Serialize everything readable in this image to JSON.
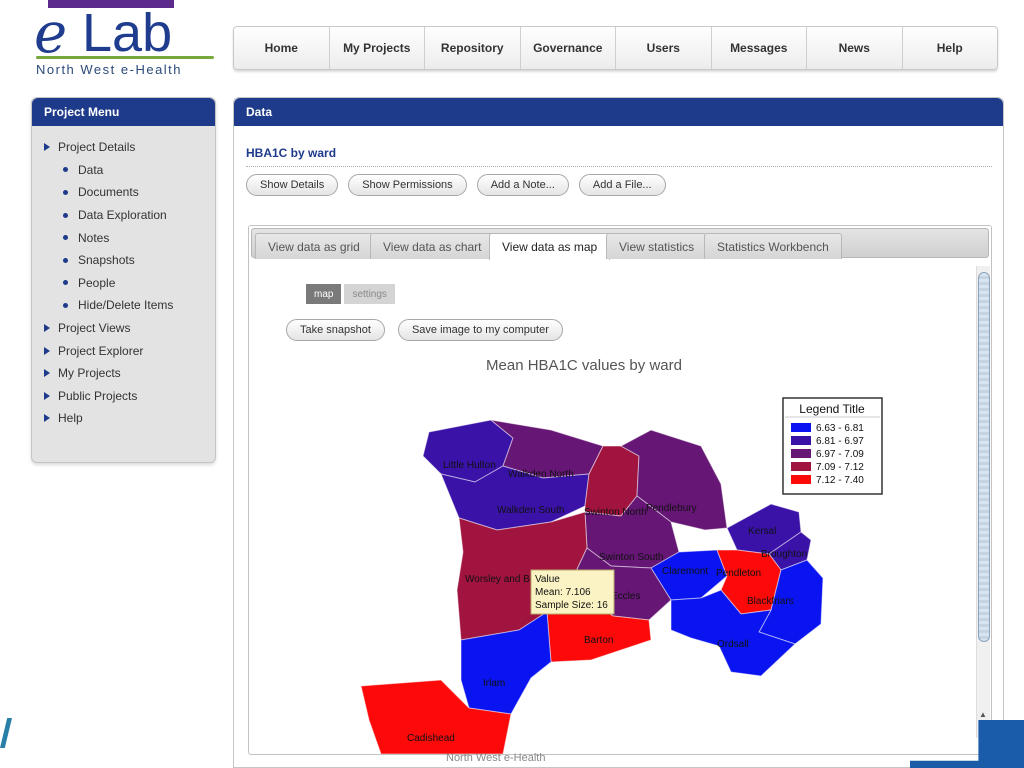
{
  "logo": {
    "text": "Lab",
    "initial": "e",
    "subtitle": "North West e-Health"
  },
  "nav": [
    {
      "label": "Home"
    },
    {
      "label": "My Projects"
    },
    {
      "label": "Repository"
    },
    {
      "label": "Governance"
    },
    {
      "label": "Users"
    },
    {
      "label": "Messages"
    },
    {
      "label": "News"
    },
    {
      "label": "Help"
    }
  ],
  "sidebar": {
    "title": "Project Menu",
    "items": [
      {
        "label": "Project Details",
        "level": "top"
      },
      {
        "label": "Data",
        "level": "sub"
      },
      {
        "label": "Documents",
        "level": "sub"
      },
      {
        "label": "Data Exploration",
        "level": "sub"
      },
      {
        "label": "Notes",
        "level": "sub"
      },
      {
        "label": "Snapshots",
        "level": "sub"
      },
      {
        "label": "People",
        "level": "sub"
      },
      {
        "label": "Hide/Delete Items",
        "level": "sub"
      },
      {
        "label": "Project Views",
        "level": "top"
      },
      {
        "label": "Project Explorer",
        "level": "top"
      },
      {
        "label": "My Projects",
        "level": "top"
      },
      {
        "label": "Public Projects",
        "level": "top"
      },
      {
        "label": "Help",
        "level": "top"
      }
    ]
  },
  "main": {
    "title": "Data",
    "subtitle": "HBA1C by ward",
    "buttons": [
      "Show Details",
      "Show Permissions",
      "Add a Note...",
      "Add a File..."
    ],
    "tabs": [
      "View data as grid",
      "View data as chart",
      "View data as map",
      "View statistics",
      "Statistics Workbench"
    ],
    "active_tab": "View data as map",
    "mini_tabs": {
      "map": "map",
      "settings": "settings"
    },
    "action_buttons": [
      "Take snapshot",
      "Save image to my computer"
    ]
  },
  "map": {
    "title": "Mean HBA1C values by ward",
    "legend_title": "Legend Title",
    "legend": [
      {
        "label": "6.63 - 6.81",
        "color": "#0a14f0"
      },
      {
        "label": "6.81 - 6.97",
        "color": "#3a12a8"
      },
      {
        "label": "6.97 - 7.09",
        "color": "#661675"
      },
      {
        "label": "7.09 - 7.12",
        "color": "#a0143f"
      },
      {
        "label": "7.12 - 7.40",
        "color": "#fc0a0a"
      }
    ],
    "wards": [
      {
        "name": "Little Hulton"
      },
      {
        "name": "Walkden North"
      },
      {
        "name": "Walkden South"
      },
      {
        "name": "Swinton North"
      },
      {
        "name": "Pendlebury"
      },
      {
        "name": "Kersal"
      },
      {
        "name": "Broughton"
      },
      {
        "name": "Swinton South"
      },
      {
        "name": "Worsley and Boothstown"
      },
      {
        "name": "Claremont"
      },
      {
        "name": "Pendleton"
      },
      {
        "name": "Eccles"
      },
      {
        "name": "Blackfriars"
      },
      {
        "name": "Barton"
      },
      {
        "name": "Ordsall"
      },
      {
        "name": "Irlam"
      },
      {
        "name": "Cadishead"
      }
    ],
    "tooltip": {
      "title": "Value",
      "mean": "Mean: 7.106",
      "sample": "Sample Size: 16"
    }
  },
  "footer": {
    "text": "North West e-Health"
  }
}
